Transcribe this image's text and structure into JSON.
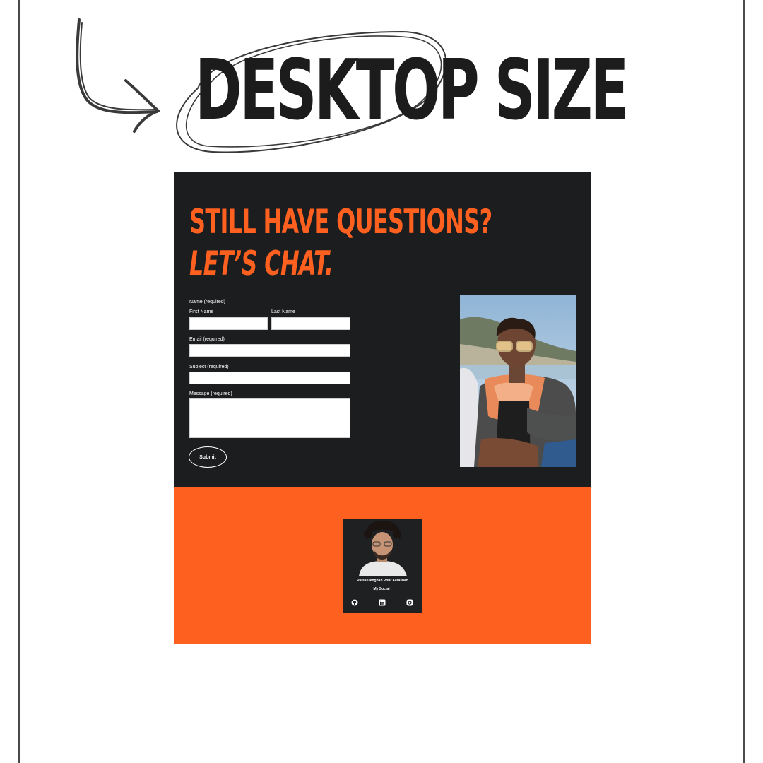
{
  "headline": "DESKTOP SIZE",
  "contact": {
    "title_line1": "STILL HAVE QUESTIONS?",
    "title_line2": "LET’S CHAT."
  },
  "form": {
    "name_label": "Name (required)",
    "first_name_label": "First Name",
    "last_name_label": "Last Name",
    "email_label": "Email (required)",
    "subject_label": "Subject (required)",
    "message_label": "Message (required)",
    "submit_label": "Submit"
  },
  "profile": {
    "name": "Parsa Dehghan Pour Farashah",
    "social_label": "My Social :",
    "social_icons": [
      "github-icon",
      "linkedin-icon",
      "instagram-icon"
    ]
  },
  "colors": {
    "background": "#ffffff",
    "dark": "#1c1d1f",
    "accent": "#fe6020",
    "ink": "#1c1c1c"
  }
}
